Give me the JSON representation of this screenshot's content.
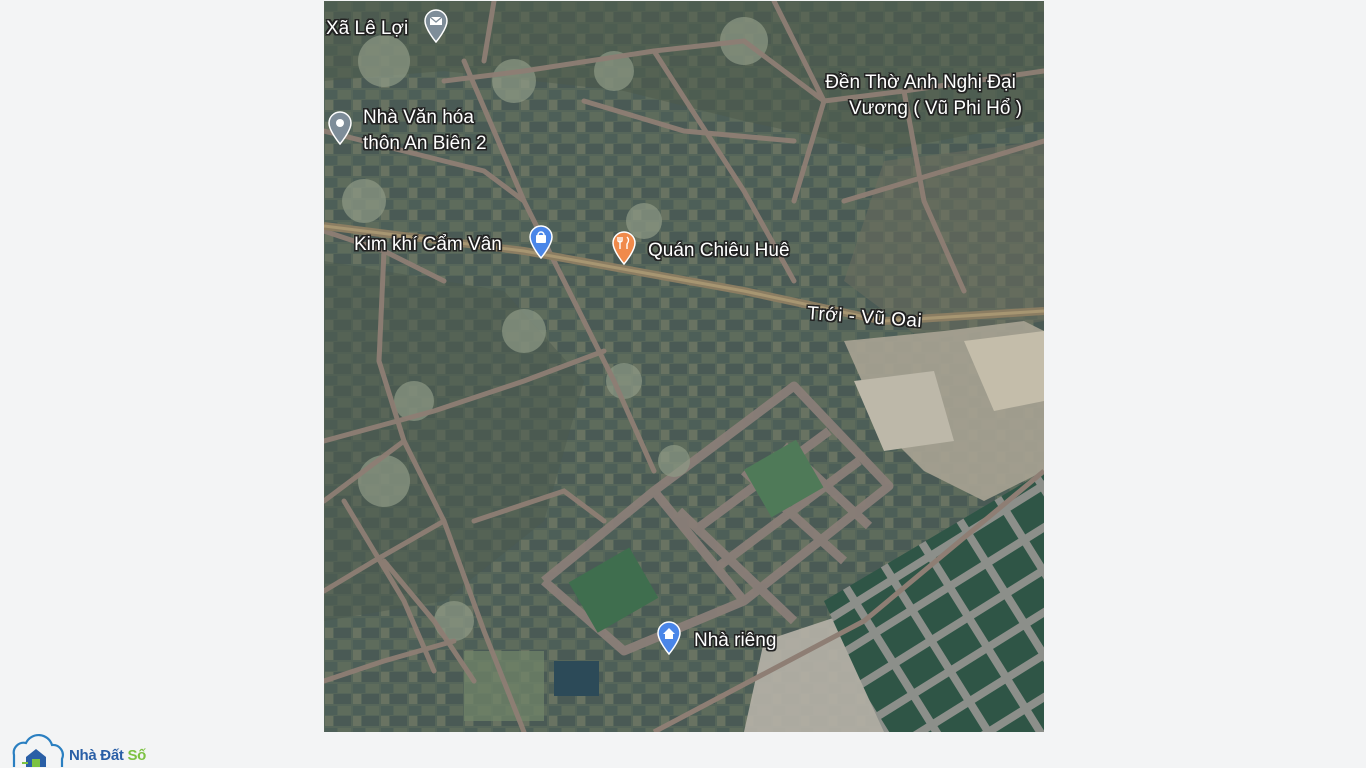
{
  "map": {
    "places": [
      {
        "name": "Xã Lê Lợi",
        "icon": "mail-pin-icon"
      },
      {
        "name": "Đền Thờ Anh Nghị Đại\nVương ( Vũ Phi Hổ )",
        "line1": "Đền Thờ Anh Nghị Đại",
        "line2": "Vương ( Vũ Phi Hổ )"
      },
      {
        "name": "Nhà Văn hóa thôn An Biên 2",
        "line1": "Nhà Văn hóa",
        "line2": "thôn An Biên 2",
        "icon": "location-pin-icon"
      },
      {
        "name": "Kim khí Cẩm Vân",
        "icon": "shopping-bag-pin-icon"
      },
      {
        "name": "Quán Chiêu Huê",
        "icon": "restaurant-pin-icon"
      },
      {
        "name": "Nhà riêng",
        "icon": "home-pin-icon"
      }
    ],
    "road_label": "Trới - Vũ Oai",
    "colors": {
      "pin_blue": "#4a86e8",
      "pin_orange": "#f08a4b",
      "pin_gray": "#7e8d99",
      "road": "#8e7e74"
    }
  },
  "logo": {
    "part1": "Nhà Đất",
    "part2": "Số",
    "icon": "house-cloud-logo-icon",
    "colors": {
      "primary": "#2a5fa6",
      "accent": "#7cc242"
    }
  }
}
